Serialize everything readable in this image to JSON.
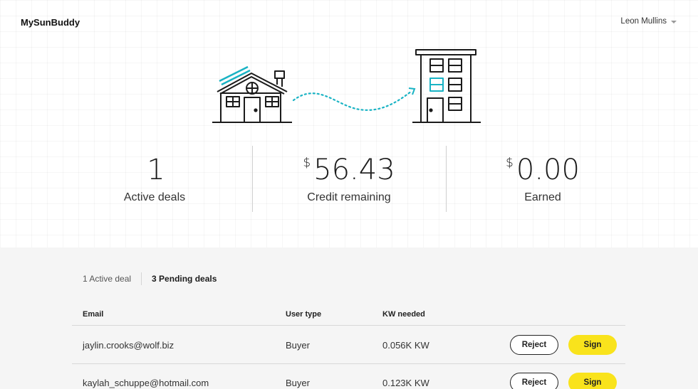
{
  "header": {
    "brand": "MySunBuddy",
    "user_name": "Leon Mullins"
  },
  "colors": {
    "accent_cyan": "#19b3c4",
    "sign_yellow": "#f9e31c"
  },
  "illustration": {
    "left_icon": "house-with-solar-panel-icon",
    "right_icon": "apartment-building-icon"
  },
  "stats": [
    {
      "value": "1",
      "currency": "",
      "label": "Active deals"
    },
    {
      "value": "56.43",
      "currency": "$",
      "label": "Credit remaining"
    },
    {
      "value": "0.00",
      "currency": "$",
      "label": "Earned"
    }
  ],
  "tabs": [
    {
      "label": "1 Active deal",
      "active": false
    },
    {
      "label": "3 Pending deals",
      "active": true
    }
  ],
  "table": {
    "columns": [
      "Email",
      "User type",
      "KW needed"
    ],
    "rows": [
      {
        "email": "jaylin.crooks@wolf.biz",
        "user_type": "Buyer",
        "kw_needed": "0.056K KW",
        "reject_label": "Reject",
        "sign_label": "Sign"
      },
      {
        "email": "kaylah_schuppe@hotmail.com",
        "user_type": "Buyer",
        "kw_needed": "0.123K KW",
        "reject_label": "Reject",
        "sign_label": "Sign"
      }
    ]
  }
}
